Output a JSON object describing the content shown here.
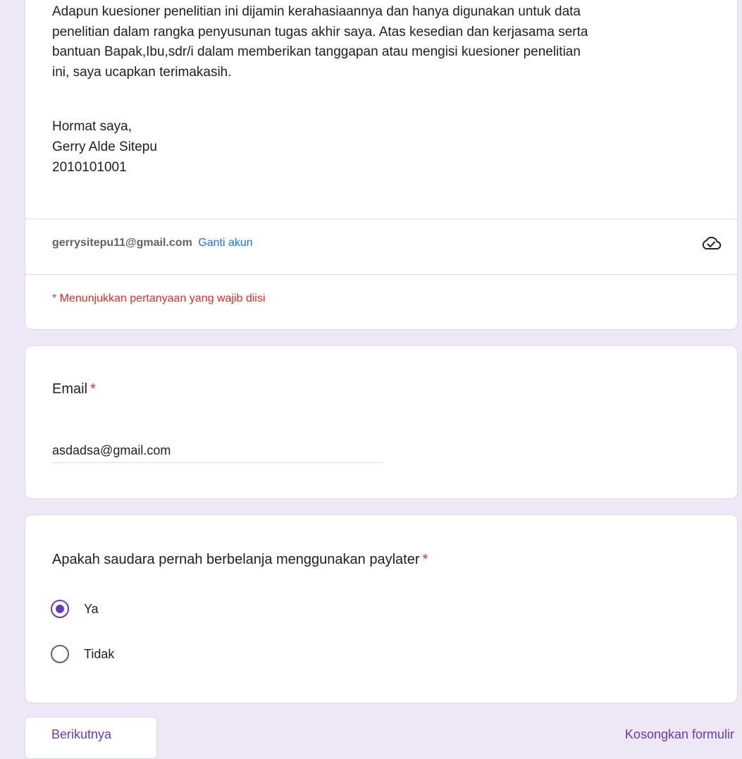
{
  "header": {
    "description_lines": [
      "Adapun kuesioner penelitian ini dijamin kerahasiaannya dan hanya digunakan untuk data",
      "penelitian dalam rangka penyusunan tugas akhir saya. Atas kesedian dan kerjasama serta",
      "bantuan Bapak,Ibu,sdr/i dalam memberikan tanggapan atau mengisi kuesioner penelitian",
      "ini, saya ucapkan terimakasih."
    ],
    "signature": {
      "greeting": "Hormat saya,",
      "name": "Gerry Alde Sitepu",
      "id": "2010101001"
    },
    "account": {
      "email": "gerrysitepu11@gmail.com",
      "switch_label": "Ganti akun",
      "cloud_icon": "cloud-check-icon"
    },
    "required_note": "* Menunjukkan pertanyaan yang wajib diisi"
  },
  "questions": {
    "email": {
      "title": "Email",
      "required_mark": "*",
      "value": "asdadsa@gmail.com"
    },
    "paylater": {
      "title": "Apakah saudara pernah berbelanja menggunakan paylater",
      "required_mark": "*",
      "options": [
        {
          "label": "Ya",
          "selected": true
        },
        {
          "label": "Tidak",
          "selected": false
        }
      ]
    }
  },
  "footer": {
    "next_label": "Berikutnya",
    "clear_label": "Kosongkan formulir"
  },
  "colors": {
    "background": "#ede7f6",
    "accent": "#673ab7",
    "required": "#d93025",
    "link": "#1a73e8"
  }
}
